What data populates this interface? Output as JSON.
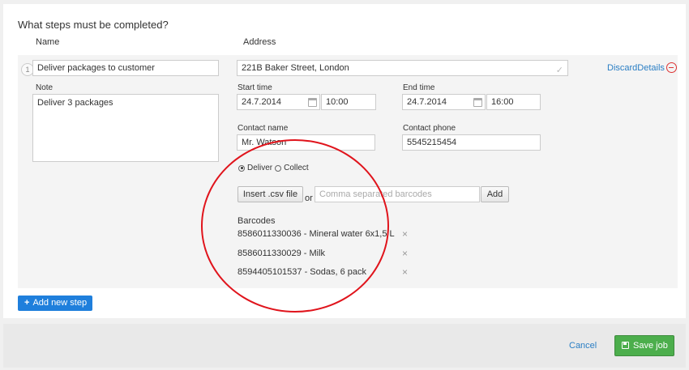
{
  "form": {
    "title": "What steps must be completed?",
    "columns": {
      "name": "Name",
      "address": "Address"
    }
  },
  "step": {
    "number": "1",
    "name": "Deliver packages to customer",
    "address": "221B Baker Street, London",
    "discard_label": "DiscardDetails",
    "note_label": "Note",
    "note": "Deliver 3 packages",
    "start_time_label": "Start time",
    "start_date": "24.7.2014",
    "start_time": "10:00",
    "end_time_label": "End time",
    "end_date": "24.7.2014",
    "end_time": "16:00",
    "contact_name_label": "Contact name",
    "contact_name": "Mr. Watson",
    "contact_phone_label": "Contact phone",
    "contact_phone": "5545215454",
    "mode": {
      "deliver": "Deliver",
      "collect": "Collect",
      "selected": "deliver"
    },
    "insert_csv_label": "Insert .csv file",
    "or_label": "or",
    "barcode_placeholder": "Comma separated barcodes",
    "add_label": "Add",
    "barcodes_label": "Barcodes",
    "barcodes": [
      "8586011330036 - Mineral water 6x1,5 L",
      "8586011330029 - Milk",
      "8594405101537 - Sodas, 6 pack"
    ]
  },
  "actions": {
    "add_step": "Add new step",
    "cancel": "Cancel",
    "save": "Save job"
  },
  "colors": {
    "primary": "#1f7fdc",
    "success": "#4cae4c",
    "link": "#2a7ec4",
    "highlight_circle": "#e0141c"
  }
}
